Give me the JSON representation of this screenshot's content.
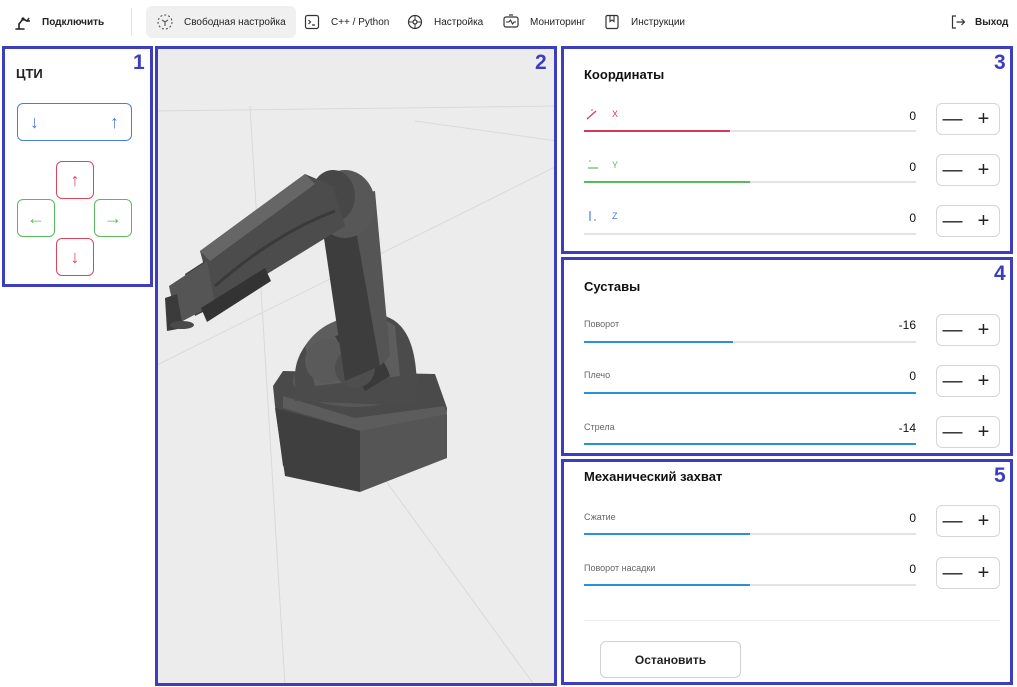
{
  "topbar": {
    "connect_label": "Подключить",
    "tabs": [
      {
        "label": "Свободная настройка",
        "icon": "free-move-icon",
        "active": true
      },
      {
        "label": "C++ / Python",
        "icon": "code-terminal-icon",
        "active": false
      },
      {
        "label": "Настройка",
        "icon": "settings-icon",
        "active": false
      },
      {
        "label": "Мониторинг",
        "icon": "monitoring-icon",
        "active": false
      },
      {
        "label": "Инструкции",
        "icon": "bookmark-icon",
        "active": false
      }
    ],
    "exit_label": "Выход"
  },
  "panel_numbers": [
    "1",
    "2",
    "3",
    "4",
    "5"
  ],
  "cti": {
    "title": "ЦТИ",
    "z_down": "↓",
    "z_up": "↑",
    "y_up": "↑",
    "x_left": "←",
    "x_right": "→",
    "y_down": "↓"
  },
  "coordinates": {
    "title": "Координаты",
    "rows": [
      {
        "label": "X",
        "value": "0",
        "fill_percent": 44,
        "color": "#d43a55"
      },
      {
        "label": "Y",
        "value": "0",
        "fill_percent": 50,
        "color": "#5cb85c"
      },
      {
        "label": "Z",
        "value": "0",
        "fill_percent": 0,
        "color": "#4a7be0"
      }
    ]
  },
  "joints": {
    "title": "Суставы",
    "rows": [
      {
        "label": "Поворот",
        "value": "-16",
        "fill_percent": 45
      },
      {
        "label": "Плечо",
        "value": "0",
        "fill_percent": 100
      },
      {
        "label": "Стрела",
        "value": "-14",
        "fill_percent": 100
      }
    ],
    "fill_color": "#2e8fd6"
  },
  "gripper": {
    "title": "Механический захват",
    "rows": [
      {
        "label": "Сжатие",
        "value": "0",
        "fill_percent": 50
      },
      {
        "label": "Поворот насадки",
        "value": "0",
        "fill_percent": 50
      }
    ],
    "fill_color": "#2e8fd6"
  },
  "stepper": {
    "minus": "—",
    "plus": "+"
  },
  "stop_label": "Остановить",
  "colors": {
    "panel_outline": "#3d3dbf",
    "accent_blue": "#4a7be0",
    "red": "#d9465f",
    "green": "#5cb85c"
  }
}
